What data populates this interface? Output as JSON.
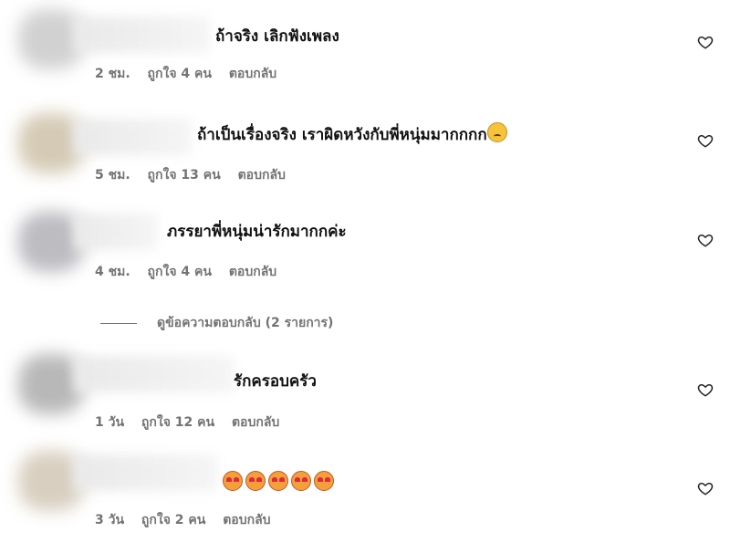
{
  "comments": [
    {
      "text": "ถ้าจริง เลิกฟังเพลง",
      "time": "2 ชม.",
      "likes": "ถูกใจ 4 คน",
      "reply": "ตอบกลับ",
      "emojis": []
    },
    {
      "text": "ถ้าเป็นเรื่องจริง เราผิดหวังกับพี่หนุ่มมากกกก",
      "time": "5 ชม.",
      "likes": "ถูกใจ 13 คน",
      "reply": "ตอบกลับ",
      "emojis": [
        "sad-face-emoji"
      ]
    },
    {
      "text": "ภรรยาพี่หนุ่มน่ารักมากกค่ะ",
      "time": "4 ชม.",
      "likes": "ถูกใจ 4 คน",
      "reply": "ตอบกลับ",
      "emojis": []
    },
    {
      "text": "รักครอบครัว",
      "time": "1 วัน",
      "likes": "ถูกใจ 12 คน",
      "reply": "ตอบกลับ",
      "emojis": []
    },
    {
      "text": "",
      "time": "3 วัน",
      "likes": "ถูกใจ 2 คน",
      "reply": "ตอบกลับ",
      "emojis": [
        "smiling-face-with-hearts-emoji",
        "smiling-face-with-hearts-emoji",
        "smiling-face-with-hearts-emoji",
        "smiling-face-with-hearts-emoji",
        "smiling-face-with-hearts-emoji"
      ]
    }
  ],
  "view_replies": "ดูข้อความตอบกลับ (2 รายการ)",
  "icons": {
    "like": "heart-outline-icon"
  },
  "colors": {
    "meta_text": "#737373",
    "comment_text": "#111111"
  }
}
